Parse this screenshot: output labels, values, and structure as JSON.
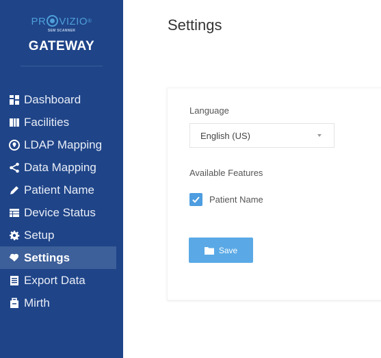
{
  "brand": {
    "name_pre": "PR",
    "name_post": "VIZIO",
    "reg_mark": "®",
    "tagline": "SEM SCANNER",
    "product": "GATEWAY"
  },
  "sidebar": {
    "items": [
      {
        "label": "Dashboard",
        "icon": "dashboard-grid-icon"
      },
      {
        "label": "Facilities",
        "icon": "book-columns-icon"
      },
      {
        "label": "LDAP Mapping",
        "icon": "map-pin-circle-icon"
      },
      {
        "label": "Data Mapping",
        "icon": "share-icon"
      },
      {
        "label": "Patient Name",
        "icon": "pencil-icon"
      },
      {
        "label": "Device Status",
        "icon": "table-icon"
      },
      {
        "label": "Setup",
        "icon": "gear-icon"
      },
      {
        "label": "Settings",
        "icon": "tag-heart-icon",
        "active": true
      },
      {
        "label": "Export Data",
        "icon": "document-list-icon"
      },
      {
        "label": "Mirth",
        "icon": "briefcase-icon"
      }
    ],
    "active_color": "#3d5f9a",
    "bg_color": "#1f4488"
  },
  "main": {
    "title": "Settings",
    "language_label": "Language",
    "language_value": "English  (US)",
    "features_label": "Available Features",
    "feature_patient_name": "Patient Name",
    "feature_patient_name_checked": true,
    "save_label": "Save",
    "accent_color": "#5aa9e6"
  }
}
